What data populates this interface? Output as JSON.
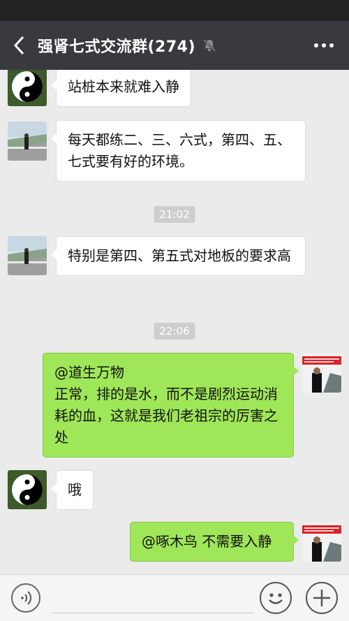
{
  "header": {
    "title": "强肾七式交流群(274)"
  },
  "messages": [
    {
      "side": "left",
      "avatar": "taiji-avatar",
      "text": "站桩本来就难入静"
    },
    {
      "side": "left",
      "avatar": "bridge-avatar",
      "text": "每天都练二、三、六式，第四、五、七式要有好的环境。"
    },
    {
      "type": "time",
      "text": "21:02"
    },
    {
      "side": "left",
      "avatar": "bridge-avatar",
      "text": "特别是第四、第五式对地板的要求高"
    },
    {
      "type": "time",
      "text": "22:06"
    },
    {
      "side": "right",
      "avatar": "banner-avatar",
      "text": "@道生万物\n正常，排的是水，而不是剧烈运动消耗的血，这就是我们老祖宗的厉害之处"
    },
    {
      "side": "left",
      "avatar": "taiji-avatar",
      "text": "哦"
    },
    {
      "side": "right",
      "avatar": "banner-avatar",
      "text": "@啄木鸟  不需要入静"
    }
  ],
  "colors": {
    "header_bg": "#393a3f",
    "chat_bg": "#ebebeb",
    "bubble_self": "#9fe658",
    "bubble_other": "#ffffff"
  },
  "icons": [
    "back-arrow-icon",
    "mute-bell-icon",
    "more-dots-icon",
    "voice-icon",
    "emoji-icon",
    "plus-icon"
  ]
}
